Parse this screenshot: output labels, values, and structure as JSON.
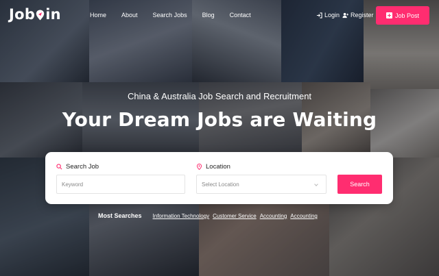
{
  "brand": {
    "logo_text_left": "Job",
    "logo_text_right": "in",
    "accent_color": "#ff2d70"
  },
  "nav": {
    "items": [
      "Home",
      "About",
      "Search Jobs",
      "Blog",
      "Contact"
    ]
  },
  "auth": {
    "login_label": "Login",
    "register_label": "Register",
    "login_icon": "sign-in-icon",
    "register_icon": "user-plus-icon"
  },
  "job_post": {
    "label": "Job Post",
    "icon": "plus-square-icon"
  },
  "hero": {
    "subtitle": "China & Australia Job Search and Recruitment",
    "headline": "Your Dream Jobs are Waiting"
  },
  "search": {
    "job_label": "Search Job",
    "job_icon": "search-icon",
    "keyword_placeholder": "Keyword",
    "location_label": "Location",
    "location_icon": "map-pin-icon",
    "location_placeholder": "Select Location",
    "button_label": "Search"
  },
  "most_searches": {
    "title": "Most Searches",
    "links": [
      "Information Technology",
      "Customer Service",
      "Accounting",
      "Accounting"
    ]
  }
}
